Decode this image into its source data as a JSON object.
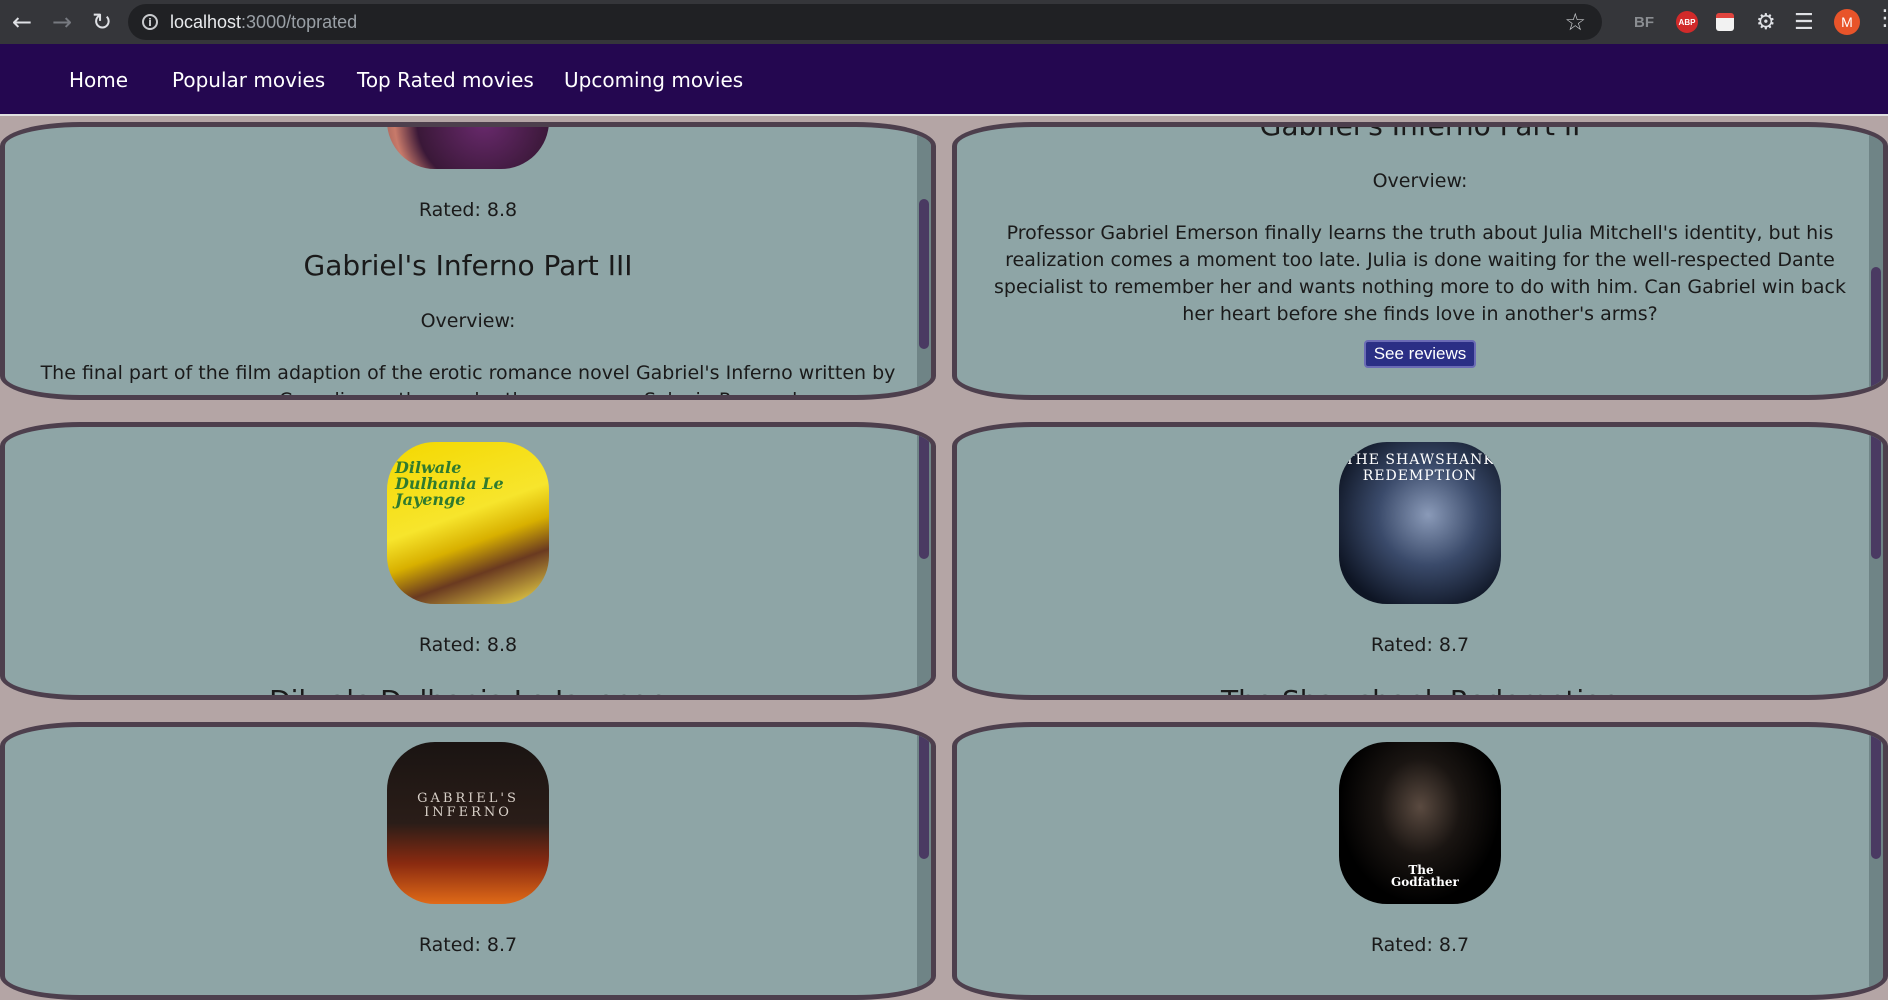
{
  "browser": {
    "url_host": "localhost",
    "url_path": ":3000/toprated",
    "ext_bf": "BF",
    "ext_abp": "ABP",
    "avatar_letter": "M"
  },
  "nav": {
    "items": [
      {
        "label": "Home"
      },
      {
        "label": "Popular movies"
      },
      {
        "label": "Top Rated movies"
      },
      {
        "label": "Upcoming movies"
      }
    ]
  },
  "cards": [
    {
      "rated": "Rated: 8.8",
      "title": "Gabriel's Inferno Part III",
      "overview_label": "Overview:",
      "overview_text": "The final part of the film adaption of the erotic romance novel Gabriel's Inferno written by an anonymous Canadian author under the pen name Sylvain Reynard."
    },
    {
      "title": "Gabriel's Inferno Part II",
      "overview_label": "Overview:",
      "overview_text": "Professor Gabriel Emerson finally learns the truth about Julia Mitchell's identity, but his realization comes a moment too late. Julia is done waiting for the well-respected Dante specialist to remember her and wants nothing more to do with him. Can Gabriel win back her heart before she finds love in another's arms?",
      "reviews_label": "See reviews"
    },
    {
      "rated": "Rated: 8.8",
      "title": "Dilwale Dulhania Le Jayenge",
      "poster_text": "Dilwale Dulhania Le Jayenge"
    },
    {
      "rated": "Rated: 8.7",
      "title": "The Shawshank Redemption",
      "poster_text": "THE SHAWSHANK REDEMPTION"
    },
    {
      "rated": "Rated: 8.7",
      "poster_text": "GABRIEL'S INFERNO"
    },
    {
      "rated": "Rated: 8.7",
      "poster_text": "The Godfather"
    }
  ]
}
